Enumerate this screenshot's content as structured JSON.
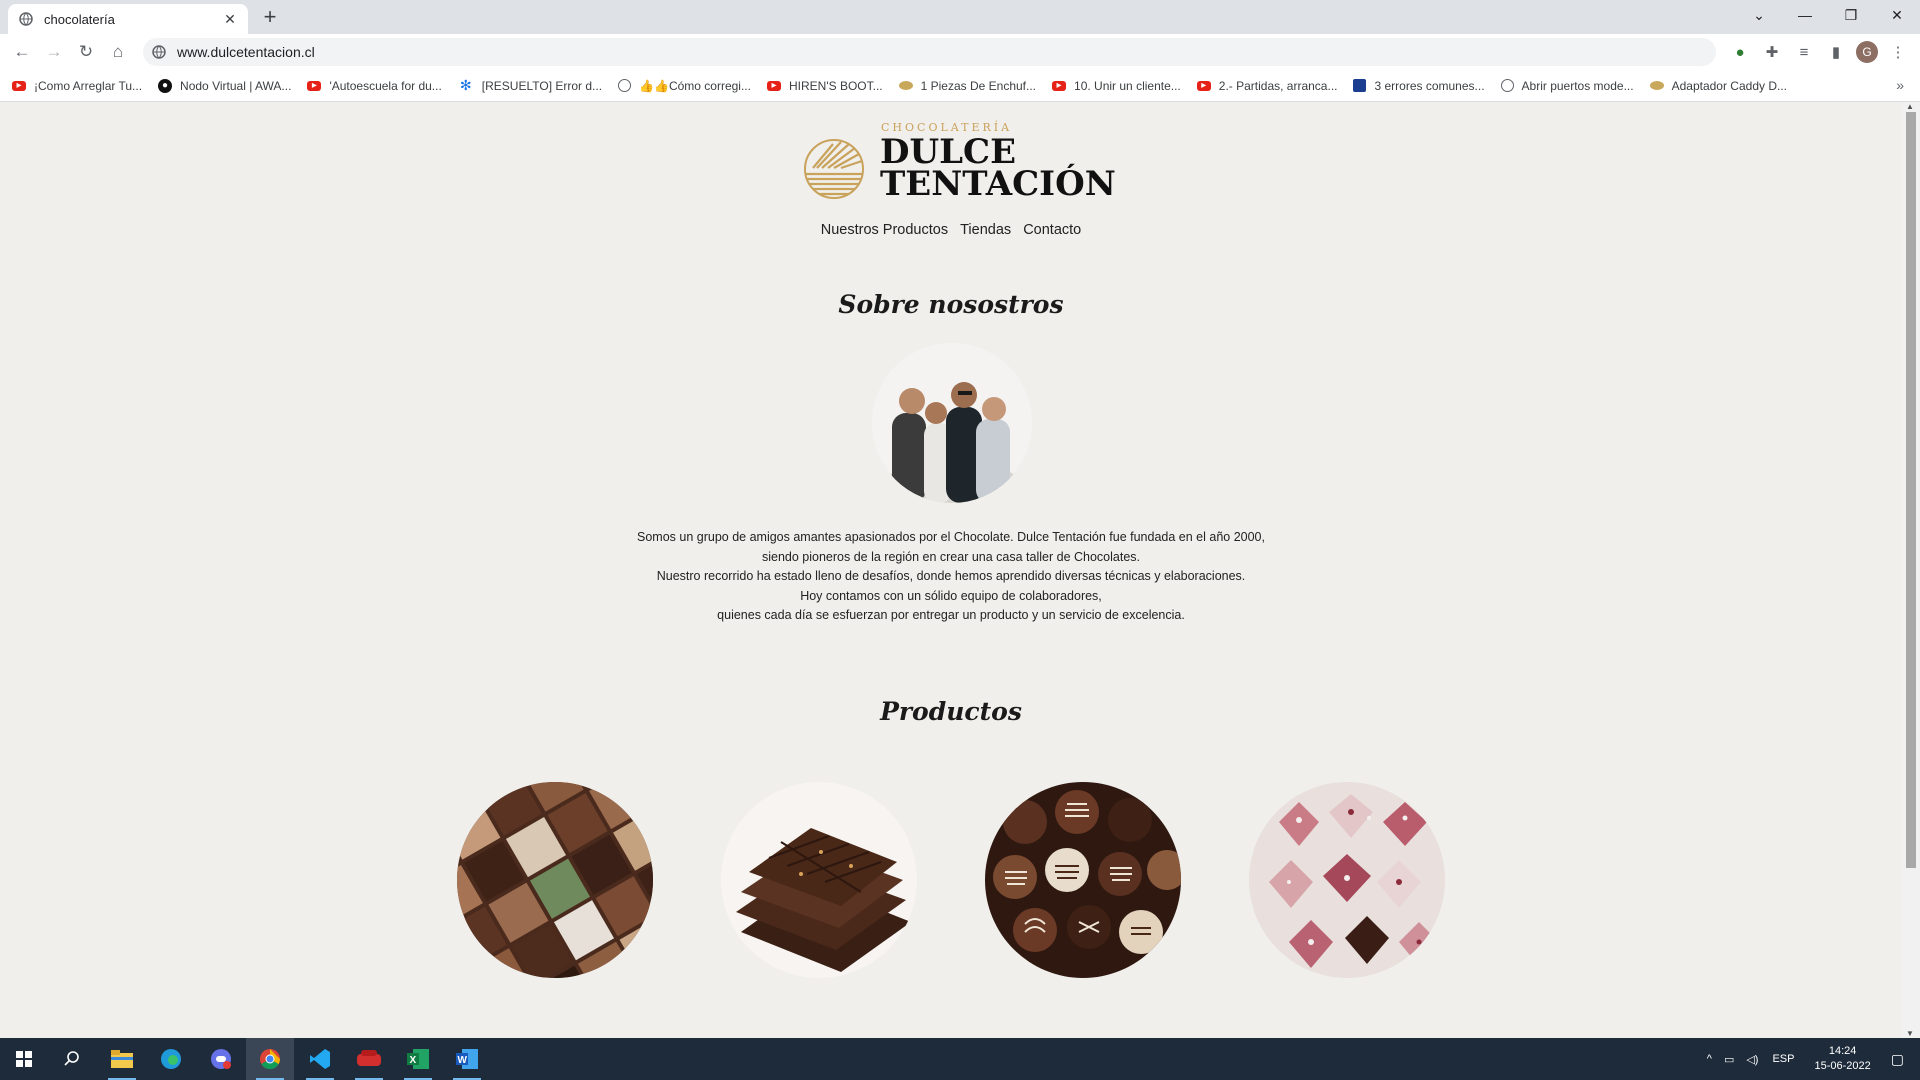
{
  "browser": {
    "tab_title": "chocolatería",
    "url": "www.dulcetentacion.cl",
    "profile_initial": "G",
    "bookmarks": [
      {
        "label": "¡Como Arreglar Tu...",
        "icon": "youtube-icon"
      },
      {
        "label": "Nodo Virtual | AWA...",
        "icon": "drop-icon"
      },
      {
        "label": "'Autoescuela for du...",
        "icon": "youtube-icon"
      },
      {
        "label": "[RESUELTO] Error d...",
        "icon": "snowflake-icon"
      },
      {
        "label": "👍👍Cómo corregi...",
        "icon": "globe-icon"
      },
      {
        "label": "HIREN'S BOOT...",
        "icon": "youtube-icon"
      },
      {
        "label": "1 Piezas De Enchuf...",
        "icon": "plug-icon"
      },
      {
        "label": "10. Unir un cliente...",
        "icon": "youtube-icon"
      },
      {
        "label": "2.- Partidas, arranca...",
        "icon": "youtube-icon"
      },
      {
        "label": "3 errores comunes...",
        "icon": "shield-icon"
      },
      {
        "label": "Abrir puertos mode...",
        "icon": "globe-icon"
      },
      {
        "label": "Adaptador Caddy D...",
        "icon": "plug-icon"
      }
    ]
  },
  "site": {
    "logo_sub": "CHOCOLATERÍA",
    "logo_line1": "DULCE",
    "logo_line2": "TENTACIÓN",
    "nav": [
      "Nuestros Productos",
      "Tiendas",
      "Contacto"
    ],
    "about_heading": "Sobre nosostros",
    "about_lines": [
      "Somos un grupo de amigos amantes apasionados por el Chocolate. Dulce Tentación fue fundada en el año 2000,",
      "siendo pioneros de la región en crear una casa taller de Chocolates.",
      "Nuestro recorrido ha estado lleno de desafíos, donde hemos aprendido diversas técnicas y elaboraciones.",
      "Hoy contamos con un sólido equipo de colaboradores,",
      "quienes cada día se esfuerzan por entregar un producto y un servicio de excelencia."
    ],
    "products_heading": "Productos",
    "colors": {
      "gold": "#c9a25b",
      "background": "#f0efeb"
    }
  },
  "taskbar": {
    "language": "ESP",
    "time": "14:24",
    "date": "15-06-2022"
  }
}
